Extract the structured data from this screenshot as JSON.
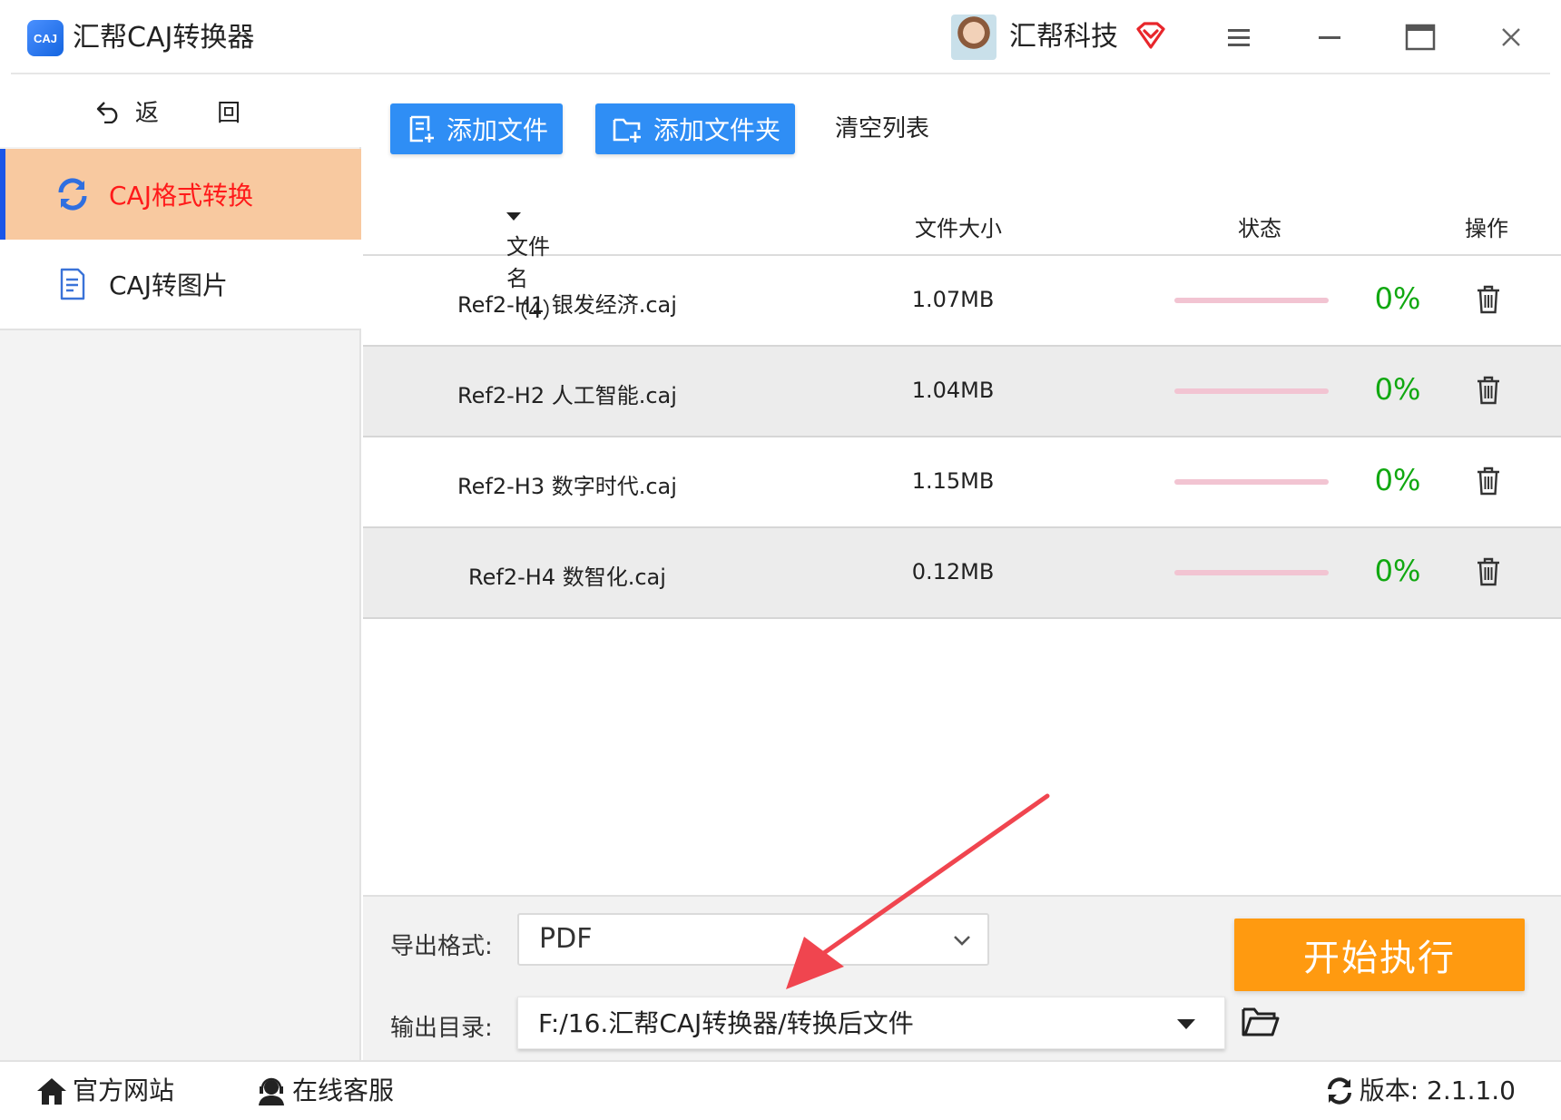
{
  "window": {
    "app_logo_text": "CAJ",
    "title": "汇帮CAJ转换器",
    "user_name": "汇帮科技"
  },
  "sidebar": {
    "back_label": "返 回",
    "items": [
      {
        "label": "CAJ格式转换",
        "active": true,
        "icon": "refresh-icon"
      },
      {
        "label": "CAJ转图片",
        "active": false,
        "icon": "document-icon"
      }
    ]
  },
  "toolbar": {
    "add_file": "添加文件",
    "add_folder": "添加文件夹",
    "clear_list": "清空列表"
  },
  "table": {
    "headers": {
      "name": "文件名（4）",
      "size": "文件大小",
      "status": "状态",
      "action": "操作"
    },
    "rows": [
      {
        "name": "Ref2-H1 银发经济.caj",
        "size": "1.07MB",
        "progress": "0%"
      },
      {
        "name": "Ref2-H2 人工智能.caj",
        "size": "1.04MB",
        "progress": "0%"
      },
      {
        "name": "Ref2-H3 数字时代.caj",
        "size": "1.15MB",
        "progress": "0%"
      },
      {
        "name": "Ref2-H4 数智化.caj",
        "size": "0.12MB",
        "progress": "0%"
      }
    ]
  },
  "output": {
    "format_label": "导出格式:",
    "format_value": "PDF",
    "dir_label": "输出目录:",
    "dir_value": "F:/16.汇帮CAJ转换器/转换后文件",
    "start_button": "开始执行"
  },
  "footer": {
    "website": "官方网站",
    "support": "在线客服",
    "version": "版本: 2.1.1.0"
  },
  "colors": {
    "accent_blue": "#2f8ef5",
    "active_nav_bg": "#f8c9a0",
    "active_nav_text": "#ff1a1a",
    "progress_text": "#11a811",
    "start_button": "#ff9a10",
    "annotation_arrow": "#f0454f"
  }
}
